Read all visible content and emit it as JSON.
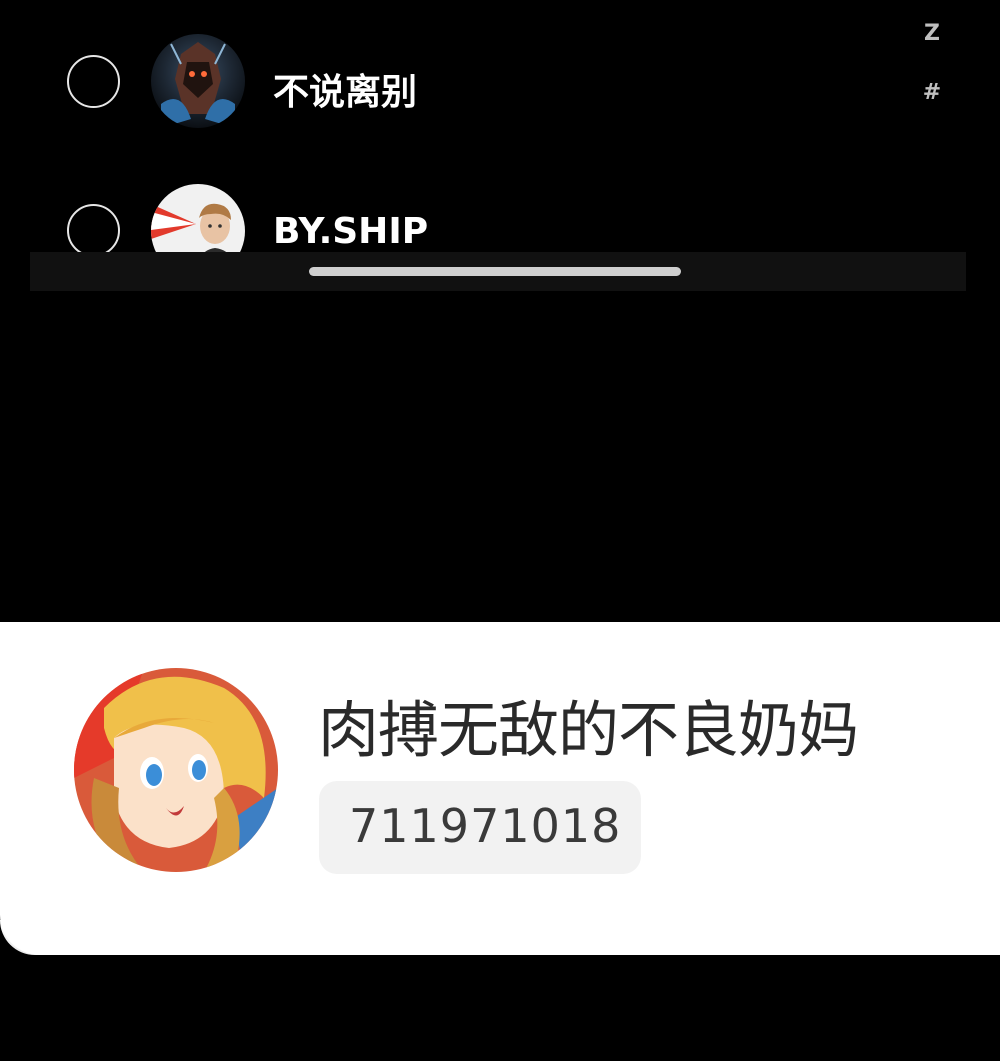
{
  "contacts": [
    {
      "name": "不说离别",
      "avatar": "dark-armored-figure-avatar",
      "selected": false
    },
    {
      "name": "BY.SHIP",
      "avatar": "young-man-portrait-avatar",
      "selected": false
    }
  ],
  "alphabet_index": [
    "Z",
    "#"
  ],
  "profile": {
    "name": "肉搏无敌的不良奶妈",
    "id": "711971018",
    "avatar": "blonde-anime-girl-avatar"
  },
  "colors": {
    "background": "#000000",
    "card": "#ffffff",
    "badge": "#f2f2f2"
  }
}
